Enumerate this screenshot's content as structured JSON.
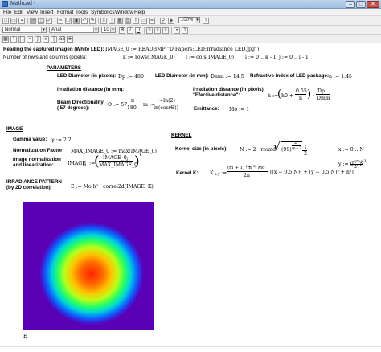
{
  "window": {
    "title": "Mathcad -",
    "min": "–",
    "max": "□",
    "close": "✕"
  },
  "menu": [
    "File",
    "Edit",
    "View",
    "Insert",
    "Format",
    "Tools",
    "Symbolics",
    "Window",
    "Help"
  ],
  "toolbar": {
    "zoom": "100%",
    "style": "Normal",
    "font": "Arial",
    "size": "10",
    "bold": "B",
    "italic": "I",
    "underline": "U"
  },
  "sheet": {
    "read_title": "Reading the captured imagen (White LED):",
    "image_def": "IMAGE_0 := READBMP(\"D:Papers:LED:Irradiance LED.jpg\")",
    "rows_cols_label": "Number of rows and columns (pixels):",
    "k_def": "k := rows(IMAGE_0)",
    "l_def": "l := cols(IMAGE_0)",
    "i_range": "i := 0 .. k - 1",
    "j_range": "j := 0 .. l - 1",
    "parameters_title": "PARAMETERS",
    "led_diam_px_label": "LED Diameter (in pixels):",
    "led_diam_px_def": "Dp := 480",
    "led_diam_mm_label": "LED Diameter (in mm):",
    "led_diam_mm_def": "Dmm := 14.5",
    "refr_label": "Refractive index of LED package:",
    "refr_def": "n := 1.45",
    "irr_dist_label": "Irradiation distance (in mm):",
    "irr_eff_label": "Irradiation distance (in pixels) \"Efective distance\":",
    "beam_label_1": "Beam Directionality",
    "beam_label_2": "( 57 degrees):",
    "theta_lhs": "Θ := 57 ·",
    "theta_num": "π",
    "theta_den": "180",
    "m_lhs": "m :=",
    "m_num": "−ln(2)",
    "m_den": "ln(cos(Θ))",
    "h_lhs": "h := ",
    "h_inner": "h0 +",
    "h_frac_num": "0.55",
    "h_frac_den": "n",
    "h_dp": "Dp",
    "h_dmm": "Dmm",
    "emittance_label": "Emittance:",
    "emittance_def": "Mo := 1",
    "image_title": "IMAGE",
    "kernel_title": "KERNEL",
    "gamma_label": "Gamma value:",
    "gamma_def": "γ := 2.2",
    "norm_label": "Normalization Factor:",
    "norm_def": "MAX_IMAGE_0 := max(IMAGE_0)",
    "kernel_size_label": "Kernel size (in pixels):",
    "kernel_size_def": "N := 2 · round",
    "kernel_size_inner": "(99)",
    "kernel_size_exp_num": "2",
    "kernel_size_exp_den": "m+3",
    "kernel_size_frac_num": "1",
    "kernel_size_frac_den": "2",
    "x_range": "x := 0 .. N",
    "y_range": "y := 0 .. N",
    "imgnorm_label_1": "Image normalization",
    "imgnorm_label_2": "and linearization:",
    "imgnorm_lhs": "IMAGE",
    "imgnorm_sub": "i,j",
    "imgnorm_assign": ":=",
    "imgnorm_num": "IMAGE_0",
    "imgnorm_num_sub": "i,j",
    "imgnorm_den": "MAX_IMAGE_0",
    "imgnorm_exp": "γ",
    "kernel_k_label": "Kernel K:",
    "kernel_k_lhs": "K",
    "kernel_k_sub": "x,y",
    "kernel_k_assign": ":=",
    "kernel_k_num": "(m + 1) · h",
    "kernel_k_num_sup": "(m+1)",
    "kernel_k_num_tail": "· Mo",
    "kernel_k_den": "2π",
    "kernel_k_body": "[(x − 0.5 N)² + (y − 0.5 N)² + h²]",
    "kernel_k_exp_num": "−(m+3)",
    "kernel_k_exp_den": "2",
    "irr_pattern_label_1": "IRRADIANCE PATTERN",
    "irr_pattern_label_2": "(by 2D correlation):",
    "e_def": "E := Mo·h² · correl2d(IMAGE, K)",
    "e_caption": "E"
  },
  "heatmap": {
    "colors": [
      "#5a00b5",
      "#2f1fd6",
      "#0a5cff",
      "#00b7ff",
      "#00e68a",
      "#5cff2e",
      "#ffe600",
      "#ff8a00",
      "#ff2200"
    ]
  }
}
